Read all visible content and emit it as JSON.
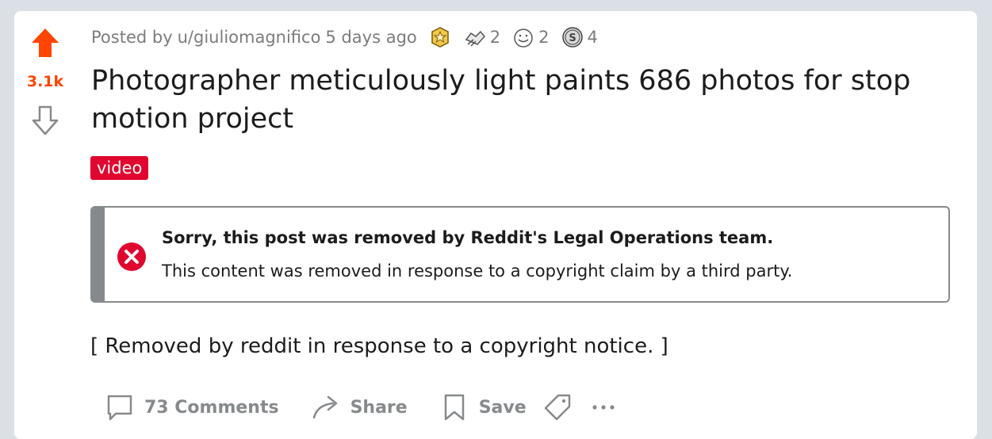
{
  "post": {
    "score": "3.1k",
    "posted_by": "Posted by",
    "username": "u/giuliomagnifico",
    "time_ago": "5 days ago",
    "awards": [
      {
        "icon": "gold-award-icon",
        "count": ""
      },
      {
        "icon": "handshake-award-icon",
        "count": "2"
      },
      {
        "icon": "wholesome-award-icon",
        "count": "2"
      },
      {
        "icon": "silver-award-icon",
        "count": "4"
      }
    ],
    "title": "Photographer meticulously light paints 686 photos for stop motion project",
    "flair": "video",
    "removed_body": "[ Removed by reddit in response to a copyright notice. ]"
  },
  "notice": {
    "title": "Sorry, this post was removed by Reddit's Legal Operations team.",
    "body": "This content was removed in response to a copyright claim by a third party."
  },
  "actions": {
    "comments": "73 Comments",
    "share": "Share",
    "save": "Save"
  },
  "colors": {
    "upvote": "#ff4500",
    "flair_bg": "#e0062f",
    "removed_icon": "#e0062f",
    "muted": "#878a8c"
  }
}
